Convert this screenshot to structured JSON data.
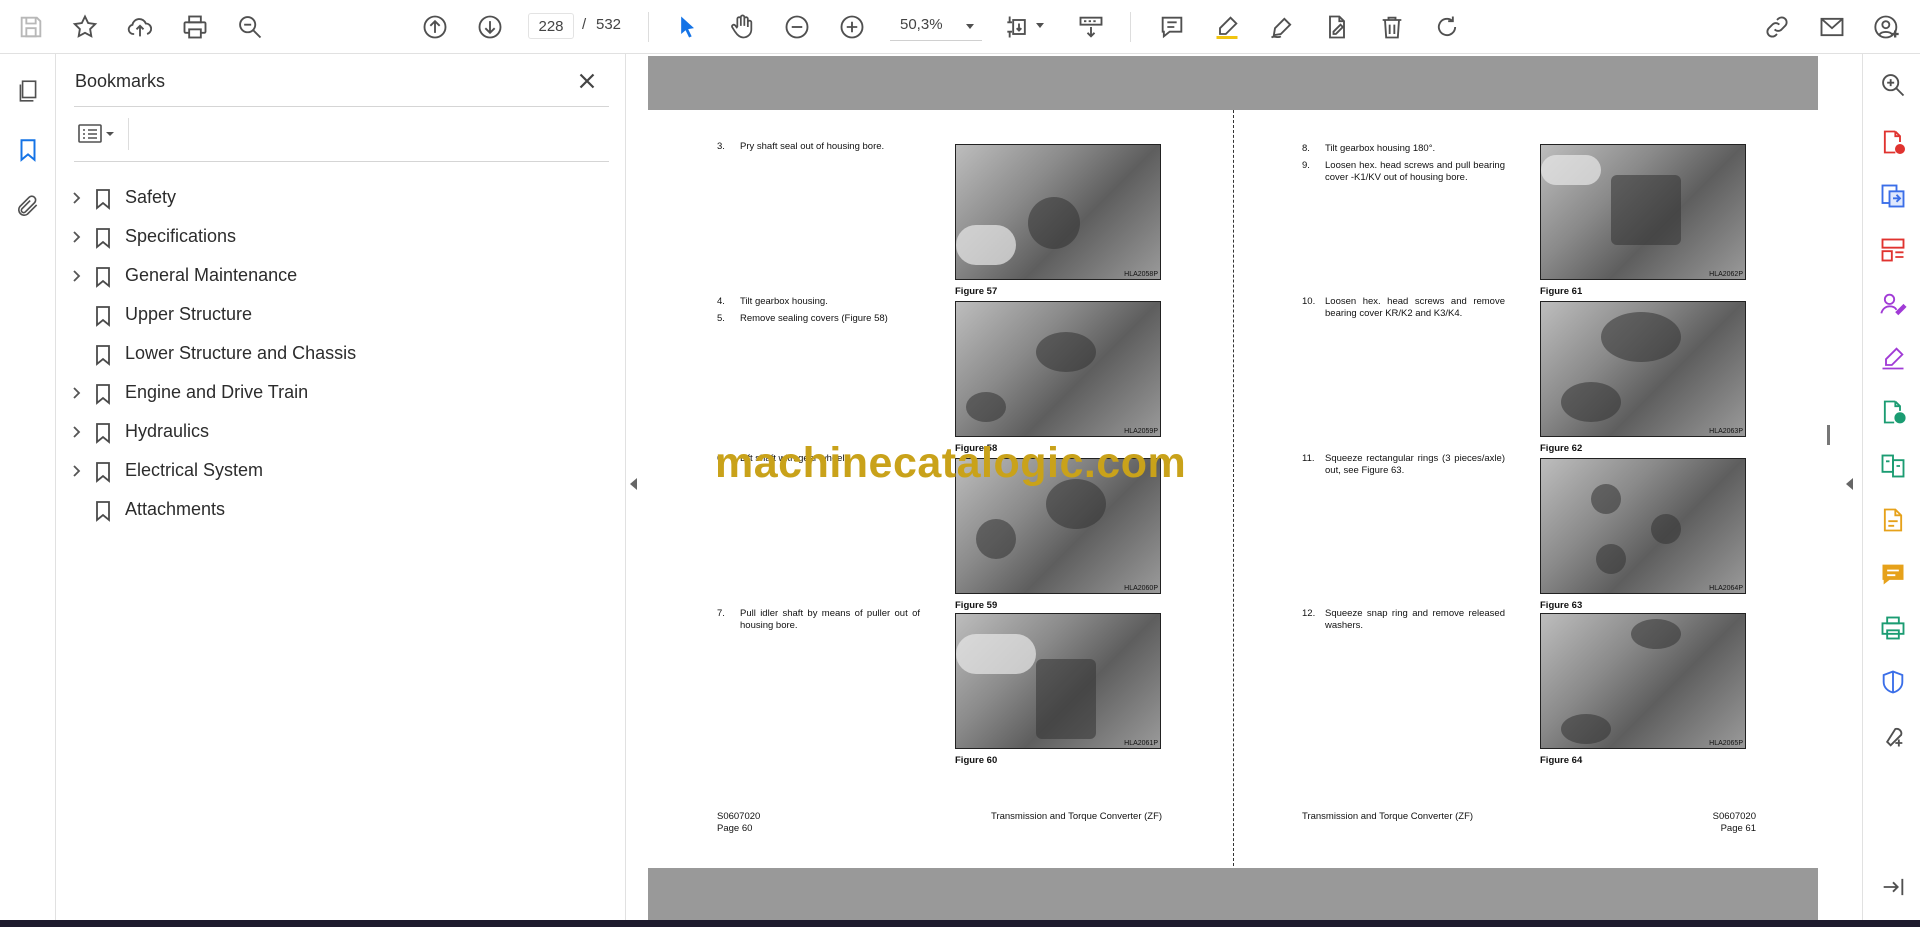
{
  "toolbar": {
    "current_page": "228",
    "page_separator": "/",
    "total_pages": "532",
    "zoom": "50,3%"
  },
  "bookmarks": {
    "title": "Bookmarks",
    "items": [
      {
        "label": "Safety",
        "expandable": true
      },
      {
        "label": "Specifications",
        "expandable": true
      },
      {
        "label": "General Maintenance",
        "expandable": true
      },
      {
        "label": "Upper Structure",
        "expandable": false
      },
      {
        "label": "Lower Structure and Chassis",
        "expandable": false
      },
      {
        "label": "Engine and Drive Train",
        "expandable": true
      },
      {
        "label": "Hydraulics",
        "expandable": true
      },
      {
        "label": "Electrical System",
        "expandable": true
      },
      {
        "label": "Attachments",
        "expandable": false
      }
    ]
  },
  "document": {
    "left_page": {
      "steps": [
        {
          "num": "3.",
          "text": "Pry shaft seal out of housing bore."
        },
        {
          "num": "4.",
          "text": "Tilt gearbox housing."
        },
        {
          "num": "5.",
          "text": "Remove sealing covers (Figure 58)"
        },
        {
          "num": "6.",
          "text": "Lift shaft with gear wheels."
        },
        {
          "num": "7.",
          "text": "Pull idler shaft by means of puller out of housing bore."
        }
      ],
      "figures": [
        {
          "caption": "Figure 57",
          "code": "HLA2058P"
        },
        {
          "caption": "Figure 58",
          "code": "HLA2059P"
        },
        {
          "caption": "Figure 59",
          "code": "HLA2060P"
        },
        {
          "caption": "Figure 60",
          "code": "HLA2061P"
        }
      ],
      "footer_doc": "S0607020",
      "footer_page": "Page 60",
      "footer_title": "Transmission and Torque Converter (ZF)"
    },
    "right_page": {
      "steps": [
        {
          "num": "8.",
          "text": "Tilt gearbox housing 180°."
        },
        {
          "num": "9.",
          "text": "Loosen hex. head screws and pull bearing cover -K1/KV out of housing bore."
        },
        {
          "num": "10.",
          "text": "Loosen hex. head screws and remove bearing cover KR/K2 and K3/K4."
        },
        {
          "num": "11.",
          "text": "Squeeze rectangular rings (3 pieces/axle) out, see Figure 63."
        },
        {
          "num": "12.",
          "text": "Squeeze snap ring and remove released washers."
        }
      ],
      "figures": [
        {
          "caption": "Figure 61",
          "code": "HLA2062P"
        },
        {
          "caption": "Figure 62",
          "code": "HLA2063P"
        },
        {
          "caption": "Figure 63",
          "code": "HLA2064P"
        },
        {
          "caption": "Figure 64",
          "code": "HLA2065P"
        }
      ],
      "footer_title": "Transmission and Torque Converter (ZF)",
      "footer_doc": "S0607020",
      "footer_page": "Page 61"
    },
    "watermark": "machinecatalogic.com"
  },
  "colors": {
    "accent": "#1473e6",
    "watermark": "#c9a21a",
    "page_gutter": "#999999"
  }
}
